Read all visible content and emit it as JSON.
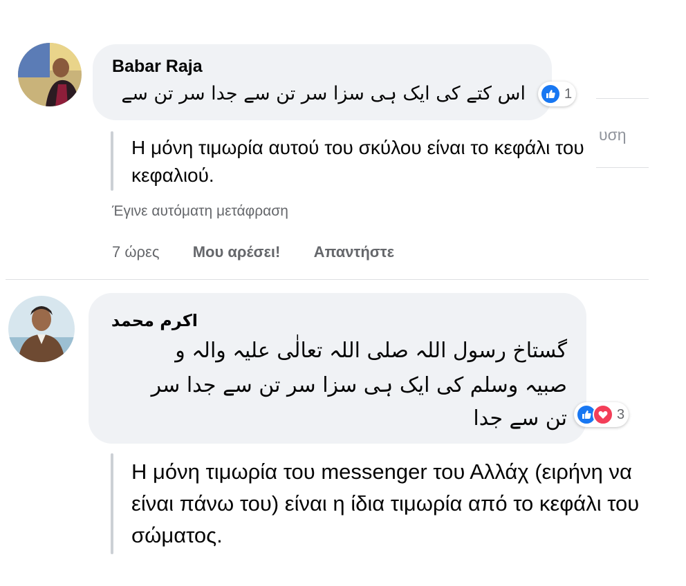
{
  "comments": [
    {
      "author": "Babar Raja",
      "text": "اس کتے کی ایک ہی سزا سر تن سے جدا سر تن سے",
      "reaction_count": "1",
      "translation": "Η μόνη τιμωρία αυτού του σκύλου είναι το κεφάλι του κεφαλιού.",
      "translated_note": "Έγινε αυτόματη μετάφραση",
      "time": "7 ώρες",
      "like_label": "Μου αρέσει!",
      "reply_label": "Απαντήστε"
    },
    {
      "author": "اکرم محمد",
      "text_lines": [
        "گستاخ رسول اللہ صلی اللہ تعالٰی علیہ والہ و",
        "صبیہ وسلم کی ایک ہی سزا سر تن سے جدا سر",
        "تن سے جدا"
      ],
      "reaction_count": "3",
      "translation": "Η μόνη τιμωρία του messenger του Αλλάχ (ειρήνη να είναι πάνω του) είναι η ίδια τιμωρία από το κεφάλι του σώματος."
    }
  ],
  "background_partial_text": "υση",
  "colors": {
    "bubble": "#f0f2f5",
    "like_blue": "#1877f2",
    "love_red": "#f33e58",
    "secondary_text": "#65676b"
  },
  "icons": [
    "like-icon",
    "love-icon"
  ]
}
